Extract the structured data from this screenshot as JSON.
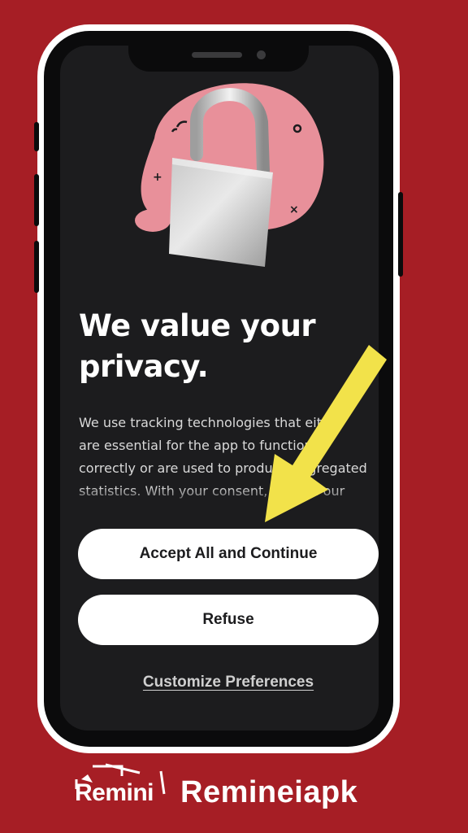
{
  "consent": {
    "title": "We value your privacy.",
    "body": "We use tracking technologies that either are essential for the app to function correctly or are used to produce aggregated statistics. With your consent, we and our third-party partners will also",
    "accept_label": "Accept All and Continue",
    "refuse_label": "Refuse",
    "customize_label": "Customize Preferences"
  },
  "footer": {
    "logo_text": "Remini",
    "brand_name": "Remineiapk"
  },
  "colors": {
    "background": "#a61e25",
    "screen": "#1c1c1e",
    "blob": "#e8909a",
    "arrow": "#f2e24a",
    "button": "#ffffff"
  },
  "icons": {
    "hero": "padlock-icon",
    "annotation": "arrow-icon"
  }
}
